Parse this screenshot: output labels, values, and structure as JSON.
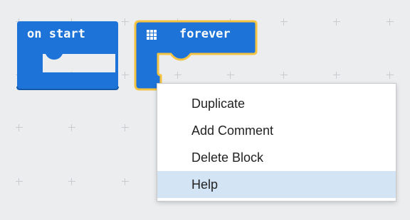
{
  "blocks": {
    "on_start": {
      "label": "on start",
      "color": "#1e73d8"
    },
    "forever": {
      "label": "forever",
      "color": "#1e73d8",
      "selected_outline": "#f5c342",
      "icon": "grid-icon"
    }
  },
  "context_menu": {
    "items": [
      {
        "label": "Duplicate"
      },
      {
        "label": "Add Comment"
      },
      {
        "label": "Delete Block"
      },
      {
        "label": "Help",
        "highlighted": true
      }
    ]
  }
}
